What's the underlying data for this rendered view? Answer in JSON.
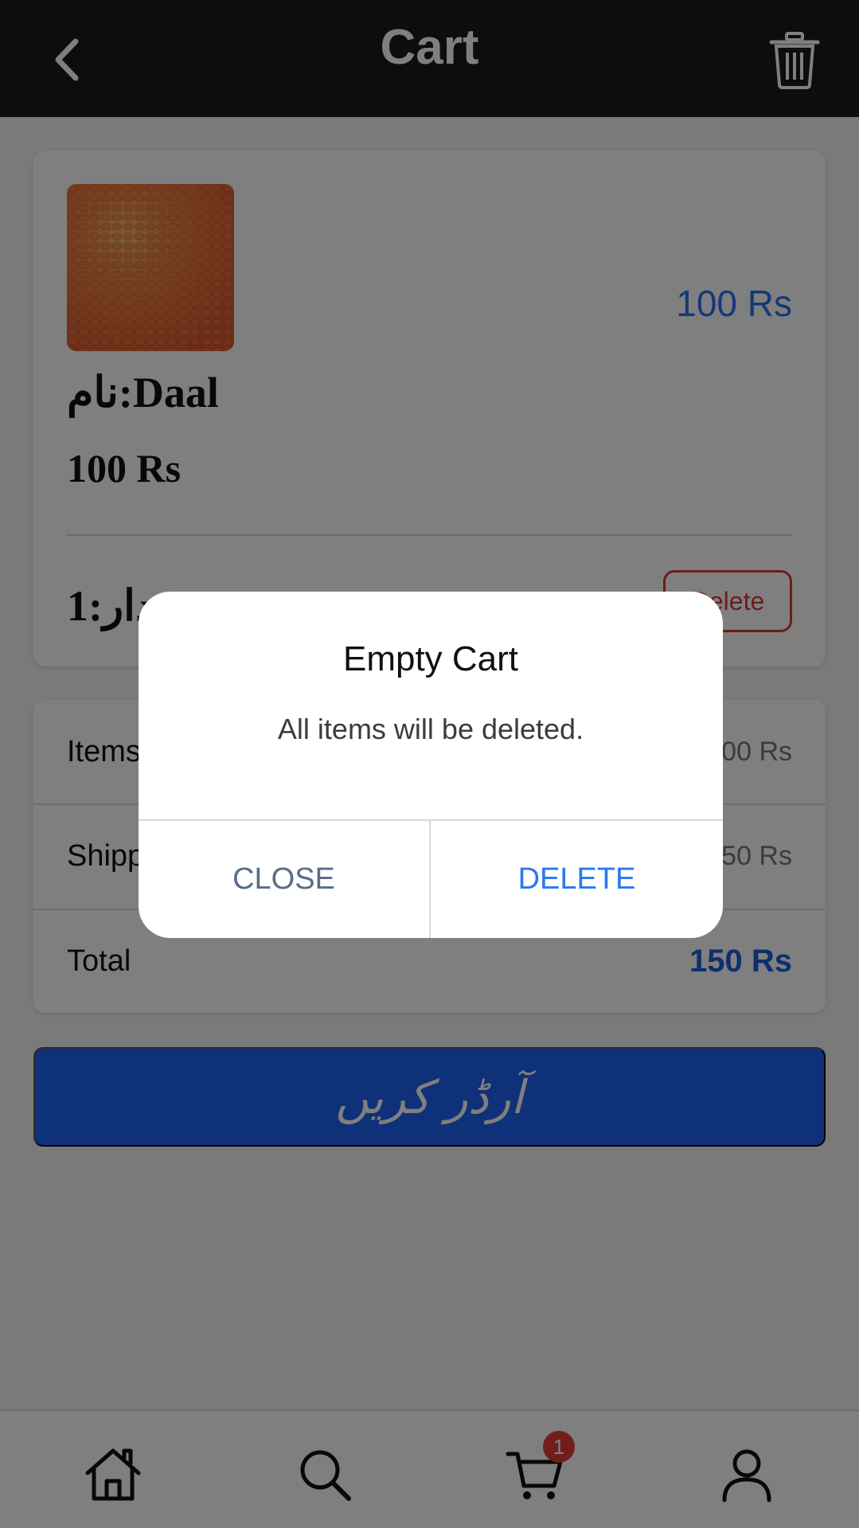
{
  "header": {
    "title": "Cart",
    "back_icon": "chevron-left-icon",
    "trash_icon": "trash-icon"
  },
  "item": {
    "price_right": "100 Rs",
    "name": "نام:Daal",
    "price": "100 Rs",
    "quantity": "مقدار:1",
    "delete_label": "Delete"
  },
  "summary": {
    "items_label": "Items",
    "items_value": "100 Rs",
    "shipping_label": "Shipping",
    "shipping_value": "50 Rs",
    "total_label": "Total",
    "total_value": "150 Rs"
  },
  "order_button": "آرڈر کریں",
  "nav": {
    "home_icon": "home-icon",
    "search_icon": "search-icon",
    "cart_icon": "cart-icon",
    "cart_badge": "1",
    "profile_icon": "user-icon"
  },
  "dialog": {
    "title": "Empty Cart",
    "message": "All items will be deleted.",
    "close_label": "CLOSE",
    "delete_label": "DELETE"
  },
  "colors": {
    "accent": "#2a72f0",
    "order_button": "#1f62f2",
    "danger": "#e03535",
    "header_bg": "#1b1b1b"
  }
}
